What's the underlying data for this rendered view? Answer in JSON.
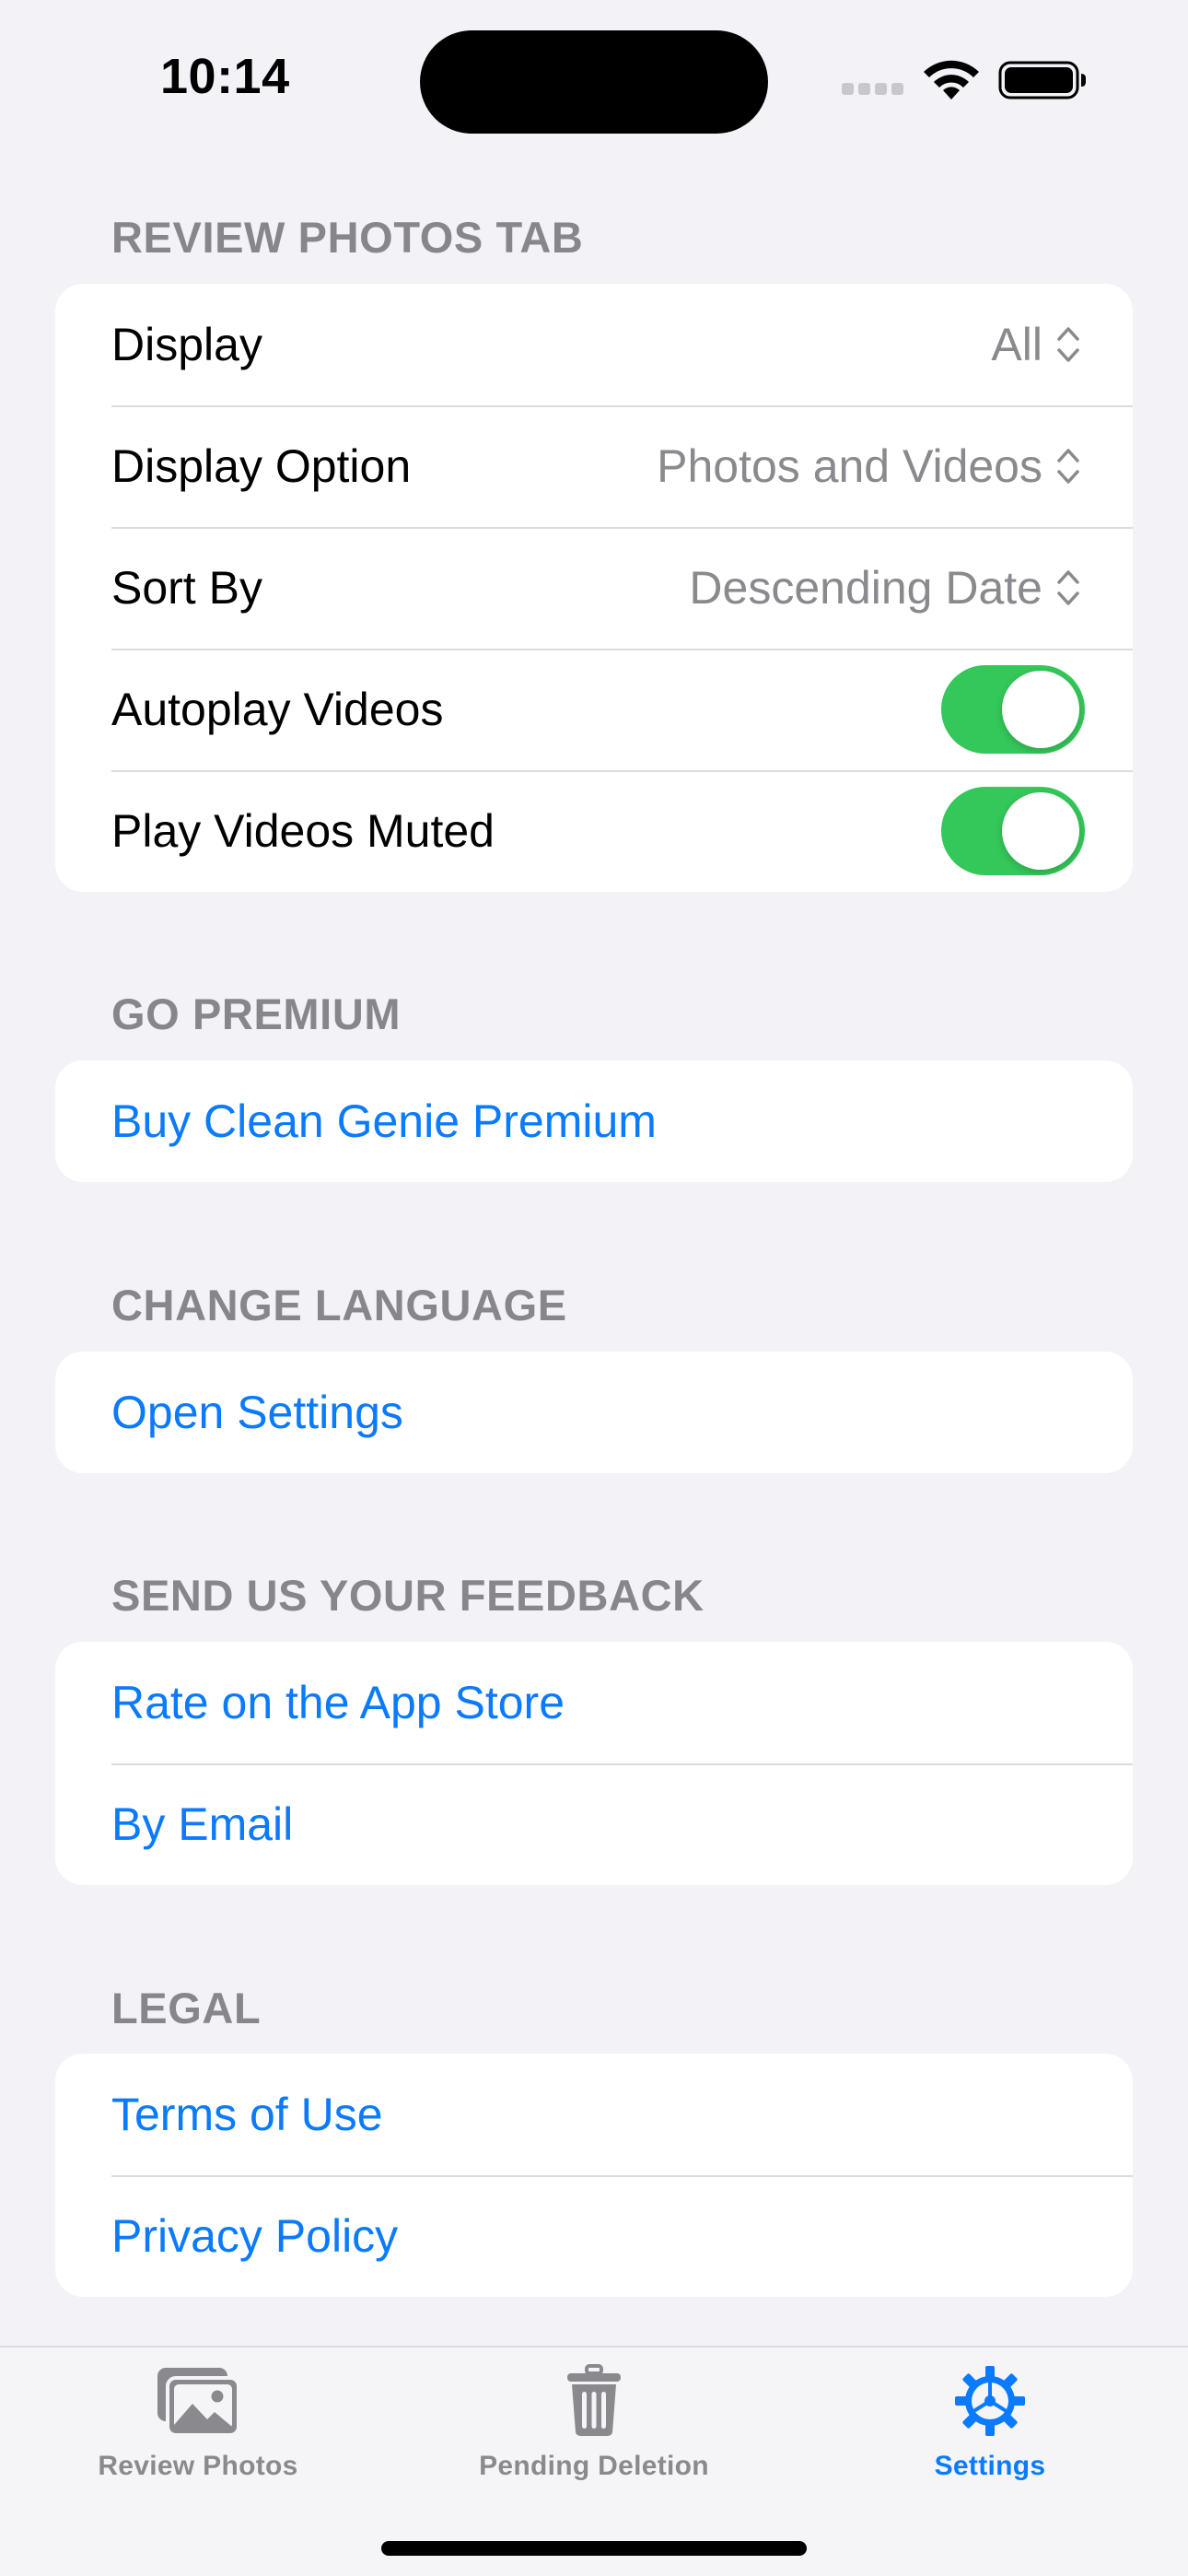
{
  "status_bar": {
    "time": "10:14"
  },
  "sections": {
    "review": {
      "header": "REVIEW PHOTOS TAB",
      "display": {
        "label": "Display",
        "value": "All"
      },
      "display_option": {
        "label": "Display Option",
        "value": "Photos and Videos"
      },
      "sort_by": {
        "label": "Sort By",
        "value": "Descending Date"
      },
      "autoplay": {
        "label": "Autoplay Videos",
        "on": true
      },
      "muted": {
        "label": "Play Videos Muted",
        "on": true
      }
    },
    "premium": {
      "header": "GO PREMIUM",
      "buy": "Buy Clean Genie Premium"
    },
    "language": {
      "header": "CHANGE LANGUAGE",
      "open_settings": "Open Settings"
    },
    "feedback": {
      "header": "SEND US YOUR FEEDBACK",
      "rate": "Rate on the App Store",
      "email": "By Email"
    },
    "legal": {
      "header": "LEGAL",
      "terms": "Terms of Use",
      "privacy": "Privacy Policy"
    }
  },
  "tab_bar": {
    "review_photos": "Review Photos",
    "pending_deletion": "Pending Deletion",
    "settings": "Settings",
    "active": "settings"
  },
  "colors": {
    "background": "#F2F2F7",
    "accent": "#0A7AFF",
    "toggle_on": "#34C759",
    "secondary_text": "#8A8A8E"
  },
  "icons": {
    "display_chevron": "chevron-up-down-icon",
    "review_tab": "photos-icon",
    "pending_tab": "trash-icon",
    "settings_tab": "gear-icon"
  }
}
